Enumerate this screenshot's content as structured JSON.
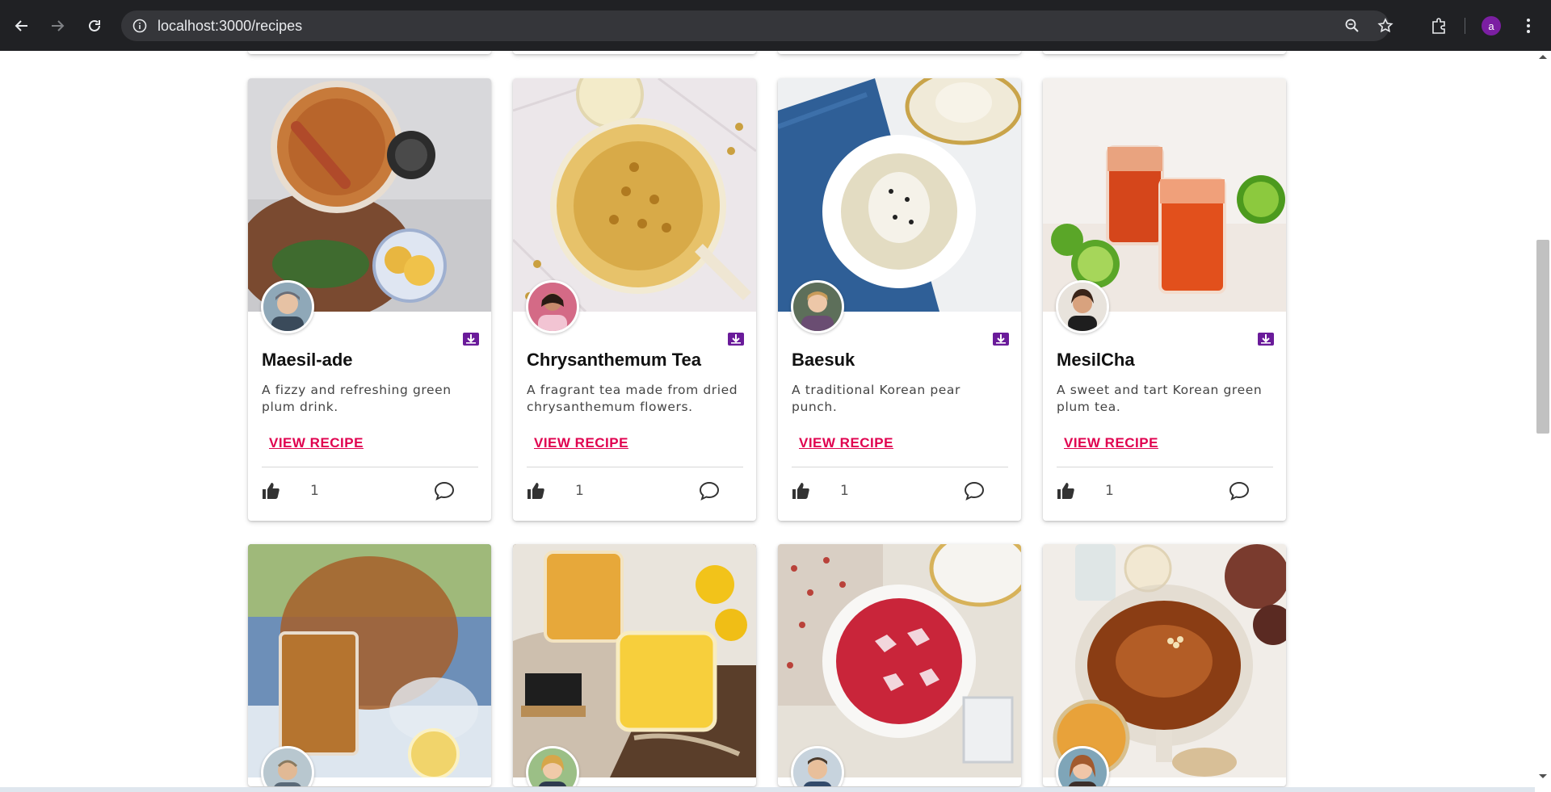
{
  "browser": {
    "url": "localhost:3000/recipes",
    "profile_initial": "a"
  },
  "recipes": [
    {
      "title": "Maesil-ade",
      "description": "A fizzy and refreshing green plum drink.",
      "link_label": "VIEW RECIPE",
      "likes": "1"
    },
    {
      "title": "Chrysanthemum Tea",
      "description": "A fragrant tea made from dried chrysanthemum flowers.",
      "link_label": "VIEW RECIPE",
      "likes": "1"
    },
    {
      "title": "Baesuk",
      "description": "A traditional Korean pear punch.",
      "link_label": "VIEW RECIPE",
      "likes": "1"
    },
    {
      "title": "MesilCha",
      "description": "A sweet and tart Korean green plum tea.",
      "link_label": "VIEW RECIPE",
      "likes": "1"
    }
  ],
  "colors": {
    "accent_link": "#e0004f",
    "save_icon": "#6a1b9a",
    "chrome_bg": "#202124"
  },
  "icons": [
    "back-icon",
    "forward-icon",
    "reload-icon",
    "info-icon",
    "zoom-icon",
    "star-icon",
    "extensions-icon",
    "menu-icon",
    "save-icon",
    "thumbs-up-icon",
    "comment-icon"
  ]
}
